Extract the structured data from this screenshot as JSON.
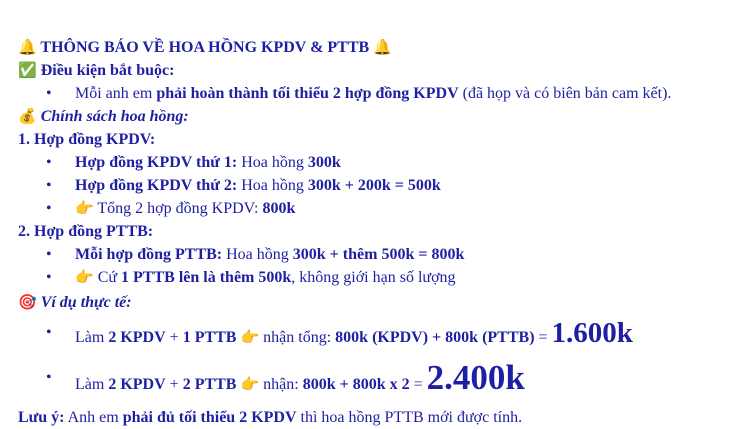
{
  "title": {
    "icon_left": "🔔",
    "text": "THÔNG BÁO VỀ HOA HỒNG KPDV & PTTB",
    "icon_right": "🔔"
  },
  "conditions": {
    "icon": "✅",
    "heading": "Điều kiện bắt buộc:",
    "item": {
      "prefix": "Mỗi anh em ",
      "bold": "phải hoàn thành tối thiểu 2 hợp đồng KPDV",
      "suffix": " (đã họp và có biên bản cam kết)."
    }
  },
  "policy": {
    "icon": "💰",
    "heading": "Chính sách hoa hồng:"
  },
  "kpdv": {
    "heading": "1. Hợp đồng KPDV:",
    "items": [
      {
        "label": "Hợp đồng KPDV thứ 1:",
        "text": " Hoa hồng ",
        "value": "300k"
      },
      {
        "label": "Hợp đồng KPDV thứ 2:",
        "text": " Hoa hồng ",
        "value": "300k + 200k = 500k"
      }
    ],
    "total": {
      "icon": "👉",
      "text": " Tổng 2 hợp đồng KPDV: ",
      "value": "800k"
    }
  },
  "pttb": {
    "heading": "2. Hợp đồng PTTB:",
    "item1": {
      "label": "Mỗi hợp đồng PTTB:",
      "text": " Hoa hồng ",
      "value": "300k + thêm 500k = 800k"
    },
    "item2": {
      "icon": "👉",
      "pre": " Cứ ",
      "bold": "1 PTTB lên là thêm 500k",
      "post": ", không giới hạn số lượng"
    }
  },
  "example": {
    "icon": "🎯",
    "heading": "Ví dụ thực tế:",
    "ex1": {
      "pre": "Làm ",
      "b1": "2 KPDV",
      "mid": " + ",
      "b2": "1 PTTB",
      "icon": "👉",
      "t2": " nhận tổng: ",
      "calc": "800k (KPDV) + 800k (PTTB)",
      "eq": " = ",
      "result": "1.600k"
    },
    "ex2": {
      "pre": "Làm ",
      "b1": "2 KPDV",
      "mid": " + ",
      "b2": "2 PTTB",
      "icon": "👉",
      "t2": " nhận: ",
      "calc": "800k + 800k x 2",
      "eq": " = ",
      "result": "2.400k"
    }
  },
  "note": {
    "label": "Lưu ý:",
    "pre": " Anh em ",
    "bold": "phải đủ tối thiểu 2 KPDV",
    "post": " thì hoa hồng PTTB mới được tính."
  }
}
